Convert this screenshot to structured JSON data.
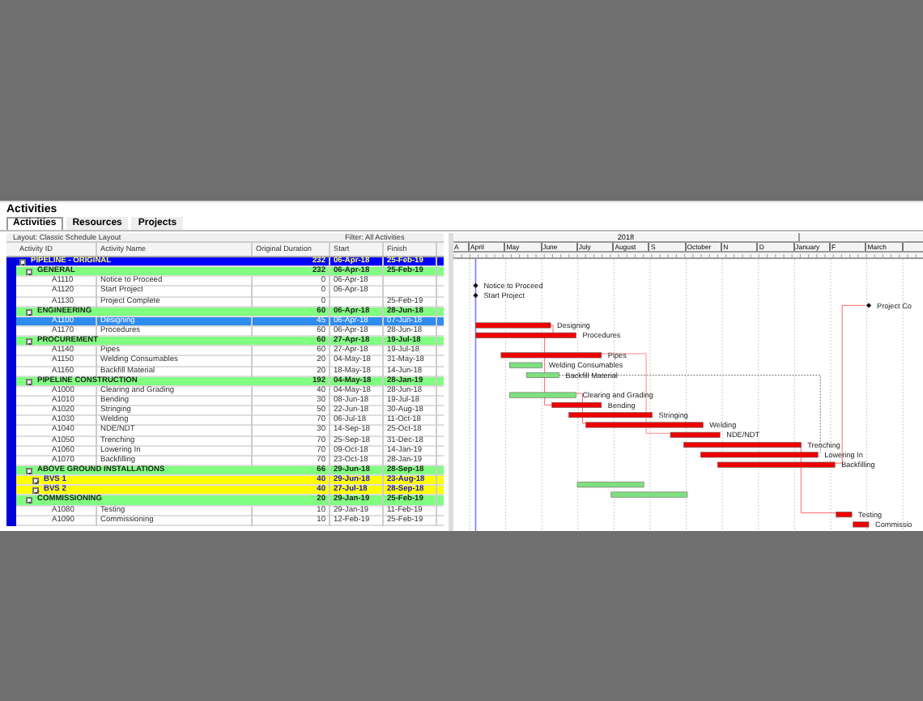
{
  "panel": {
    "title": "Activities"
  },
  "tabs": [
    {
      "label": "Activities",
      "selected": true
    },
    {
      "label": "Resources",
      "selected": false
    },
    {
      "label": "Projects",
      "selected": false
    }
  ],
  "layout_bar": {
    "layout": "Layout: Classic Schedule Layout",
    "filter": "Filter: All Activities"
  },
  "table": {
    "columns": [
      "Activity ID",
      "Activity Name",
      "Original Duration",
      "Start",
      "Finish"
    ],
    "rows": [
      {
        "kind": "project",
        "expanded": true,
        "selected": false,
        "name": "PIPELINE - ORIGINAL",
        "duration": "232",
        "start": "06-Apr-18",
        "finish": "25-Feb-19"
      },
      {
        "kind": "wbs",
        "expanded": true,
        "selected": false,
        "name": "GENERAL",
        "duration": "232",
        "start": "06-Apr-18",
        "finish": "25-Feb-19"
      },
      {
        "kind": "activity",
        "selected": false,
        "id": "A1110",
        "name": "Notice to Proceed",
        "duration": "0",
        "start": "06-Apr-18",
        "bar": {
          "kind": "milestone",
          "label": "Notice to Proceed"
        }
      },
      {
        "kind": "activity",
        "selected": false,
        "id": "A1120",
        "name": "Start Project",
        "duration": "0",
        "start": "06-Apr-18",
        "bar": {
          "kind": "milestone",
          "label": "Start Project"
        }
      },
      {
        "kind": "activity",
        "selected": false,
        "id": "A1130",
        "name": "Project Complete",
        "duration": "0",
        "finish": "25-Feb-19",
        "bar": {
          "kind": "milestone",
          "label": "Project Co"
        }
      },
      {
        "kind": "wbs",
        "expanded": true,
        "selected": false,
        "name": "ENGINEERING",
        "duration": "60",
        "start": "06-Apr-18",
        "finish": "28-Jun-18"
      },
      {
        "kind": "activity",
        "selected": true,
        "id": "A1100",
        "name": "Designing",
        "duration": "45",
        "start": "06-Apr-18",
        "finish": "07-Jun-18",
        "bar": {
          "kind": "critical",
          "label": "Designing"
        }
      },
      {
        "kind": "activity",
        "selected": false,
        "id": "A1170",
        "name": "Procedures",
        "duration": "60",
        "start": "06-Apr-18",
        "finish": "28-Jun-18",
        "bar": {
          "kind": "critical",
          "label": "Procedures"
        }
      },
      {
        "kind": "wbs",
        "expanded": true,
        "selected": false,
        "name": "PROCUREMENT",
        "duration": "60",
        "start": "27-Apr-18",
        "finish": "19-Jul-18"
      },
      {
        "kind": "activity",
        "selected": false,
        "id": "A1140",
        "name": "Pipes",
        "duration": "60",
        "start": "27-Apr-18",
        "finish": "19-Jul-18",
        "bar": {
          "kind": "critical",
          "label": "Pipes"
        }
      },
      {
        "kind": "activity",
        "selected": false,
        "id": "A1150",
        "name": "Welding Consumables",
        "duration": "20",
        "start": "04-May-18",
        "finish": "31-May-18",
        "bar": {
          "kind": "noncritical",
          "label": "Welding Consumables"
        }
      },
      {
        "kind": "activity",
        "selected": false,
        "id": "A1160",
        "name": "Backfill Material",
        "duration": "20",
        "start": "18-May-18",
        "finish": "14-Jun-18",
        "bar": {
          "kind": "noncritical",
          "label": "Backfill Material"
        }
      },
      {
        "kind": "wbs",
        "expanded": true,
        "selected": false,
        "name": "PIPELINE CONSTRUCTION",
        "duration": "192",
        "start": "04-May-18",
        "finish": "28-Jan-19"
      },
      {
        "kind": "activity",
        "selected": false,
        "id": "A1000",
        "name": "Clearing and Grading",
        "duration": "40",
        "start": "04-May-18",
        "finish": "28-Jun-18",
        "bar": {
          "kind": "noncritical",
          "label": "Clearing and Grading"
        }
      },
      {
        "kind": "activity",
        "selected": false,
        "id": "A1010",
        "name": "Bending",
        "duration": "30",
        "start": "08-Jun-18",
        "finish": "19-Jul-18",
        "bar": {
          "kind": "critical",
          "label": "Bending"
        }
      },
      {
        "kind": "activity",
        "selected": false,
        "id": "A1020",
        "name": "Stringing",
        "duration": "50",
        "start": "22-Jun-18",
        "finish": "30-Aug-18",
        "bar": {
          "kind": "critical",
          "label": "Stringing"
        }
      },
      {
        "kind": "activity",
        "selected": false,
        "id": "A1030",
        "name": "Welding",
        "duration": "70",
        "start": "06-Jul-18",
        "finish": "11-Oct-18",
        "bar": {
          "kind": "critical",
          "label": "Welding"
        }
      },
      {
        "kind": "activity",
        "selected": false,
        "id": "A1040",
        "name": "NDE/NDT",
        "duration": "30",
        "start": "14-Sep-18",
        "finish": "25-Oct-18",
        "bar": {
          "kind": "critical",
          "label": "NDE/NDT"
        }
      },
      {
        "kind": "activity",
        "selected": false,
        "id": "A1050",
        "name": "Trenching",
        "duration": "70",
        "start": "25-Sep-18",
        "finish": "31-Dec-18",
        "bar": {
          "kind": "critical",
          "label": "Trenching"
        }
      },
      {
        "kind": "activity",
        "selected": false,
        "id": "A1060",
        "name": "Lowering In",
        "duration": "70",
        "start": "09-Oct-18",
        "finish": "14-Jan-19",
        "bar": {
          "kind": "critical",
          "label": "Lowering In"
        }
      },
      {
        "kind": "activity",
        "selected": false,
        "id": "A1070",
        "name": "Backfilling",
        "duration": "70",
        "start": "23-Oct-18",
        "finish": "28-Jan-19",
        "bar": {
          "kind": "critical",
          "label": "Backfilling"
        }
      },
      {
        "kind": "wbs",
        "expanded": true,
        "selected": false,
        "name": "ABOVE GROUND INSTALLATIONS",
        "duration": "66",
        "start": "29-Jun-18",
        "finish": "28-Sep-18"
      },
      {
        "kind": "assignment",
        "expanded": false,
        "selected": false,
        "name": "BVS 1",
        "duration": "40",
        "start": "29-Jun-18",
        "finish": "23-Aug-18",
        "bar": {
          "kind": "noncritical"
        }
      },
      {
        "kind": "assignment",
        "expanded": false,
        "selected": false,
        "name": "BVS 2",
        "duration": "40",
        "start": "27-Jul-18",
        "finish": "28-Sep-18",
        "bar": {
          "kind": "noncritical"
        }
      },
      {
        "kind": "wbs",
        "expanded": true,
        "selected": false,
        "name": "COMMISSIONING",
        "duration": "20",
        "start": "29-Jan-19",
        "finish": "25-Feb-19"
      },
      {
        "kind": "activity",
        "selected": false,
        "id": "A1080",
        "name": "Testing",
        "duration": "10",
        "start": "29-Jan-19",
        "finish": "11-Feb-19",
        "bar": {
          "kind": "critical",
          "label": "Testing"
        }
      },
      {
        "kind": "activity",
        "selected": false,
        "id": "A1090",
        "name": "Commissioning",
        "duration": "10",
        "start": "12-Feb-19",
        "finish": "25-Feb-19",
        "bar": {
          "kind": "critical",
          "label": "Commissio"
        }
      }
    ]
  },
  "gantt": {
    "year": "2018",
    "months": [
      "A",
      "April",
      "May",
      "June",
      "July",
      "August",
      "S",
      "October",
      "N",
      "D",
      "January",
      "F",
      "March"
    ]
  }
}
